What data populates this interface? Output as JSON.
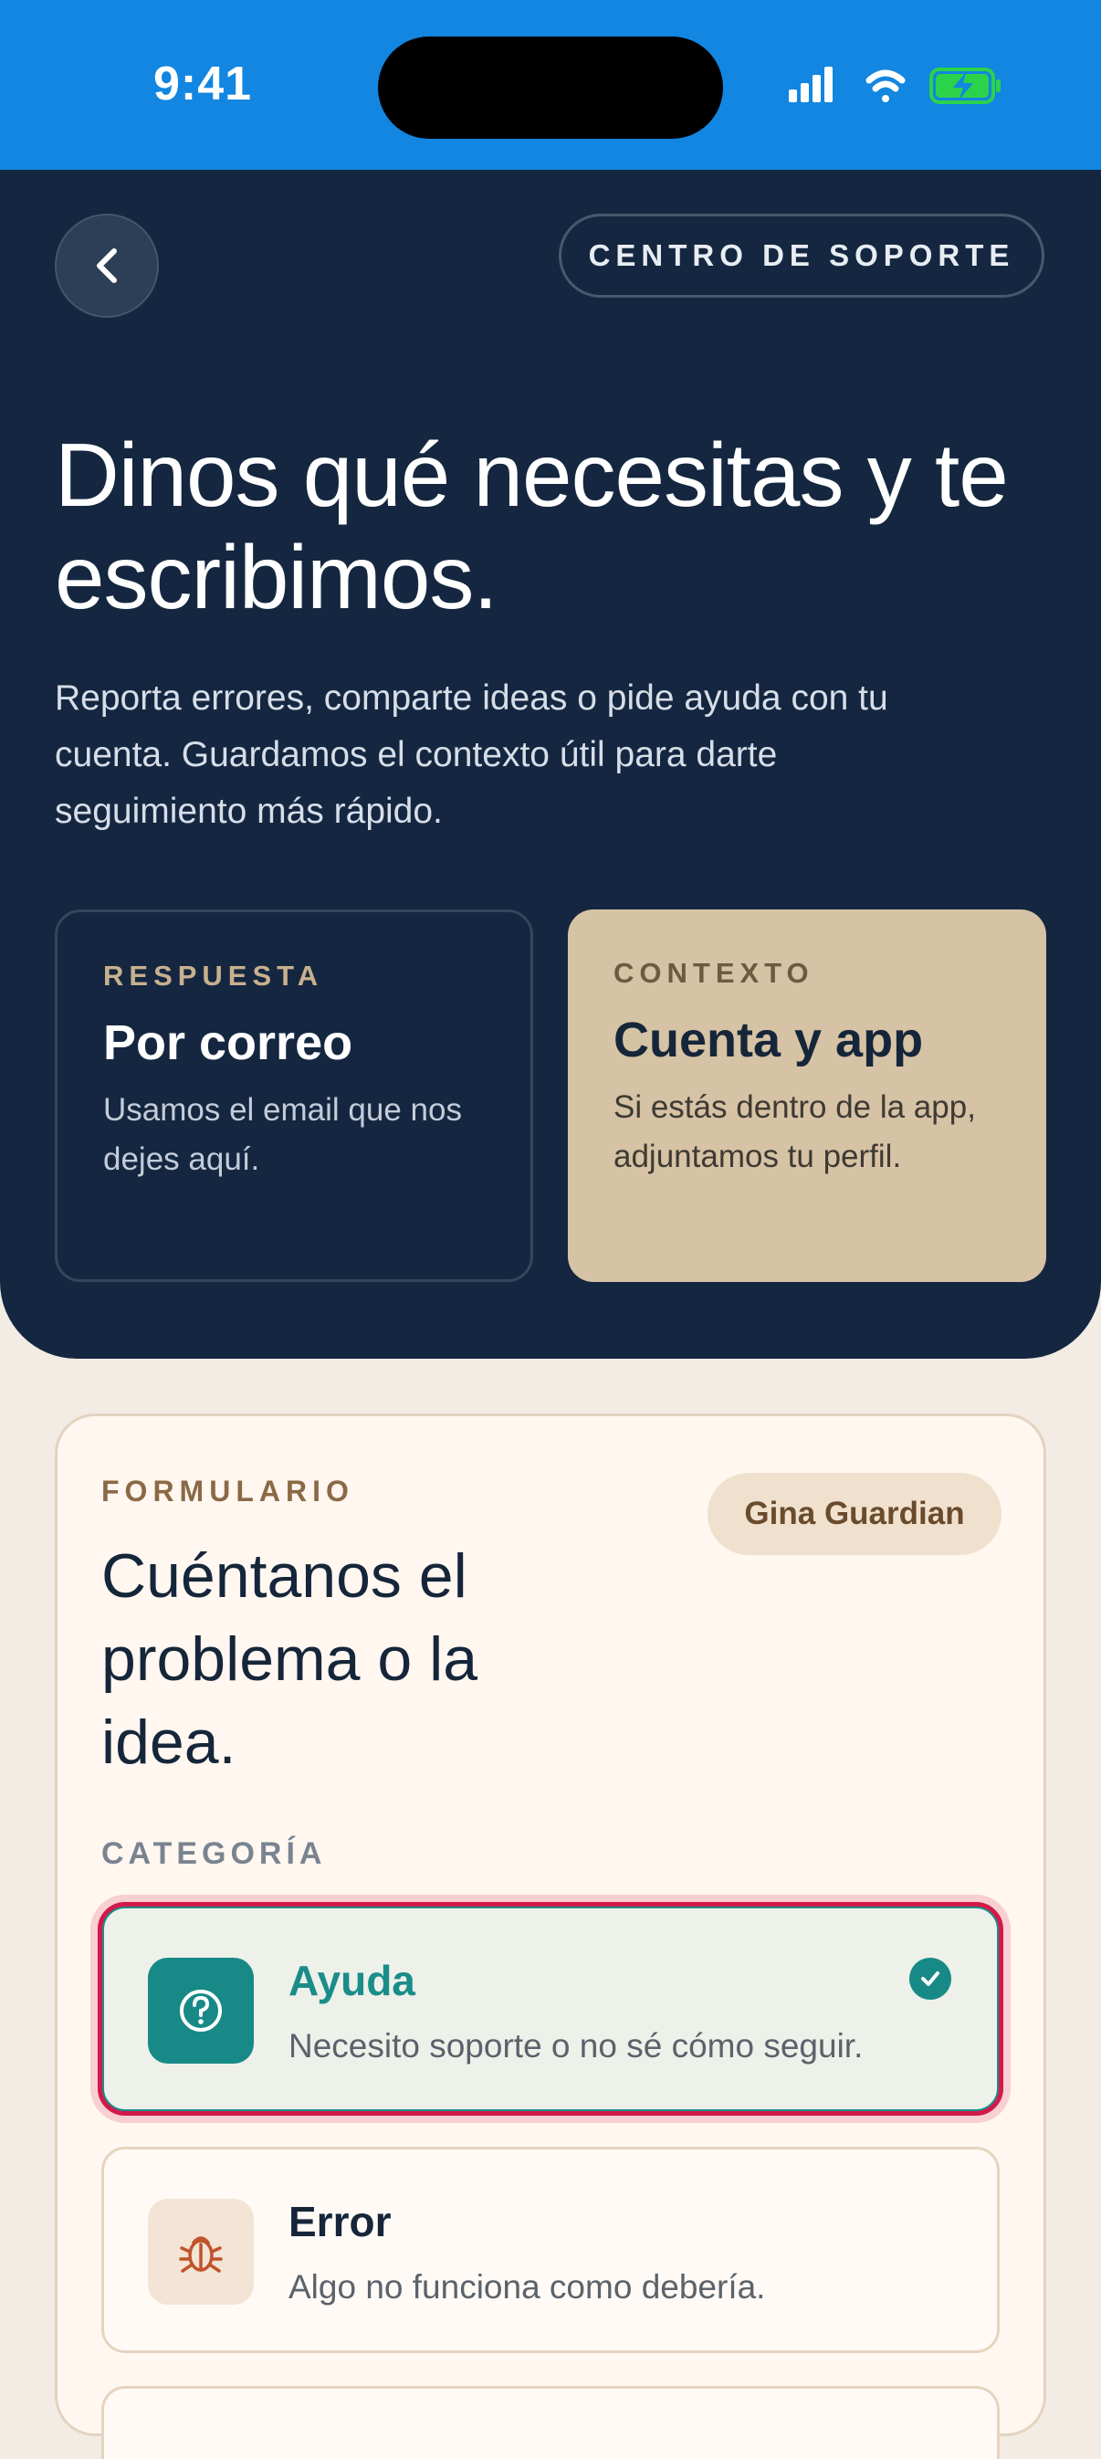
{
  "status_bar": {
    "time": "9:41",
    "icons": [
      "signal-icon",
      "wifi-icon",
      "battery-charging-icon"
    ]
  },
  "header": {
    "back_icon": "chevron-left-icon",
    "badge": "CENTRO DE SOPORTE",
    "title": "Dinos qué necesitas y te escribimos.",
    "description": "Reporta errores, comparte ideas o pide ayuda con tu cuenta. Guardamos el contexto útil para darte seguimiento más rápido.",
    "cards": [
      {
        "eyebrow": "RESPUESTA",
        "title": "Por correo",
        "body": "Usamos el email que nos dejes aquí."
      },
      {
        "eyebrow": "CONTEXTO",
        "title": "Cuenta y app",
        "body": "Si estás dentro de la app, adjuntamos tu perfil."
      }
    ]
  },
  "form": {
    "eyebrow": "FORMULARIO",
    "user": "Gina Guardian",
    "title": "Cuéntanos el problema o la idea.",
    "category_label": "CATEGORÍA",
    "options": [
      {
        "title": "Ayuda",
        "description": "Necesito soporte o no sé cómo seguir.",
        "icon": "question-circle-icon",
        "selected": true
      },
      {
        "title": "Error",
        "description": "Algo no funciona como debería.",
        "icon": "bug-icon",
        "selected": false
      }
    ]
  },
  "colors": {
    "status_bar": "#1286e0",
    "hero": "#152740",
    "accent_teal": "#178a87",
    "tan_card": "#d6c2a4",
    "page_bg": "#f3ece5",
    "selection_outline": "#d21a4a"
  }
}
